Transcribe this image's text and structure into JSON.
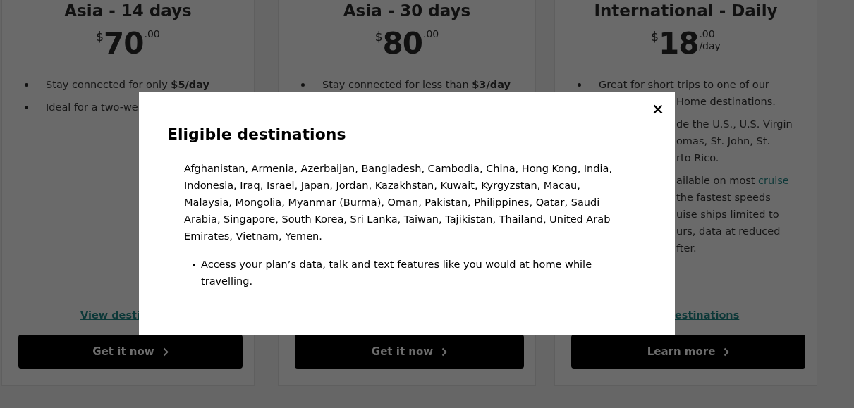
{
  "plans": [
    {
      "title": "Asia - 14 days",
      "price": {
        "currency": "$",
        "amount": "70",
        "cents": ".00"
      },
      "features": [
        {
          "lines": [
            {
              "text": "Stay connected for only **$5/day**"
            }
          ]
        },
        {
          "lines": [
            {
              "text": "Ideal for a two-we"
            }
          ]
        }
      ],
      "link": {
        "text": "View desti"
      },
      "button": "Get it now"
    },
    {
      "title": "Asia - 30 days",
      "price": {
        "currency": "$",
        "amount": "80",
        "cents": ".00"
      },
      "features": [
        {
          "lines": [
            {
              "text": "Stay connected for less than **$3/day**"
            }
          ]
        }
      ],
      "button": "Get it now"
    },
    {
      "title": "International - Daily",
      "price": {
        "currency": "$",
        "amount": "18",
        "cents": ".00",
        "unit": "/day"
      },
      "features": [
        {
          "lines": [
            {
              "text": "Great for short trips to one of our"
            },
            {
              "text": "Home destinations.",
              "covered_start": true
            }
          ]
        },
        {
          "lines": [
            {
              "text": "de the U.S., U.S. Virgin",
              "covered_start": true
            },
            {
              "text": "omas, St. John, St.",
              "covered_start": true
            },
            {
              "text": "rto Rico.",
              "covered_start": true
            }
          ]
        },
        {
          "lines": [
            {
              "text": "ailable on most ",
              "link": "cruise",
              "covered_start": true
            },
            {
              "text": "the fastest speeds",
              "covered_start": true
            },
            {
              "text": "uise ships limited to",
              "covered_start": true
            },
            {
              "text": "urs, data at reduced",
              "covered_start": true
            },
            {
              "text": "fter.",
              "covered_start": true
            }
          ]
        }
      ],
      "link": {
        "text": "estinations",
        "covered_start": true
      },
      "button": "Learn more"
    }
  ],
  "modal": {
    "title": "Eligible destinations",
    "paragraph": "Afghanistan, Armenia, Azerbaijan, Bangladesh, Cambodia, China, Hong Kong, India, Indonesia, Iraq, Israel, Japan, Jordan, Kazakhstan, Kuwait, Kyrgyzstan, Macau, Malaysia, Mongolia, Myanmar (Burma), Oman, Pakistan, Philippines, Qatar, Saudi Arabia, Singapore, South Korea, Sri Lanka, Taiwan, Tajikistan, Thailand, United Arab Emirates, Vietnam, Yemen.",
    "bullets": [
      "Access your plan’s data, talk and text features like you would at home while travelling."
    ]
  }
}
